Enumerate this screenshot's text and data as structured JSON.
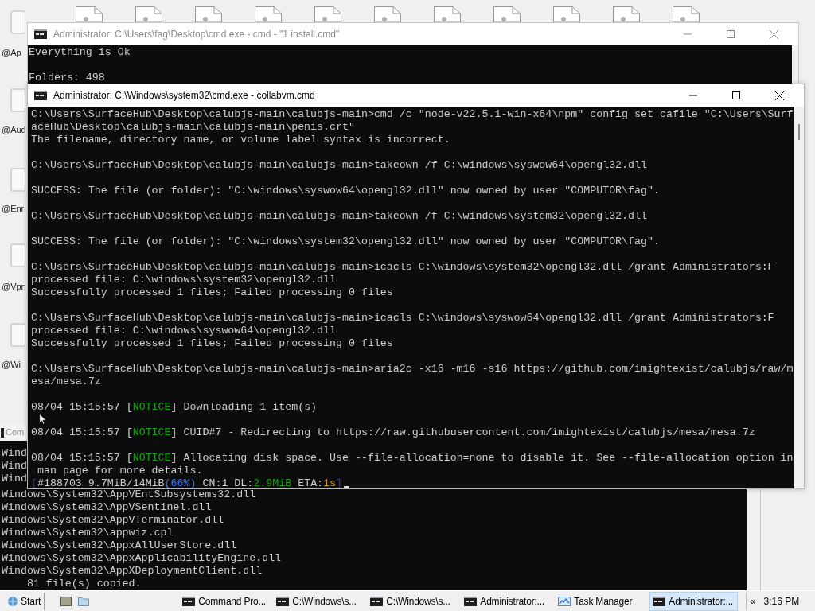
{
  "desktop": {
    "icon_labels": [
      "@Ap",
      "@Aud",
      "@Enr",
      "@Vpn",
      "@Wi"
    ]
  },
  "back_window": {
    "title": "Administrator: C:\\Users\\fag\\Desktop\\cmd.exe - cmd - \"1 install.cmd\"",
    "active": false,
    "lines": [
      {
        "kind": "text",
        "text": "Everything is Ok"
      },
      {
        "kind": "blank"
      },
      {
        "kind": "text",
        "text": "Folders: 498"
      }
    ]
  },
  "bottom_window": {
    "title": "Com",
    "active": false,
    "lines": [
      {
        "kind": "text",
        "text": "Wind"
      },
      {
        "kind": "text",
        "text": "Wind"
      },
      {
        "kind": "text",
        "text": "Wind"
      },
      {
        "kind": "text",
        "text": "Windows\\System32\\AppVEntSubsystems32.dll"
      },
      {
        "kind": "text",
        "text": "Windows\\System32\\AppVSentinel.dll"
      },
      {
        "kind": "text",
        "text": "Windows\\System32\\AppVTerminator.dll"
      },
      {
        "kind": "text",
        "text": "Windows\\System32\\appwiz.cpl"
      },
      {
        "kind": "text",
        "text": "Windows\\System32\\AppxAllUserStore.dll"
      },
      {
        "kind": "text",
        "text": "Windows\\System32\\AppxApplicabilityEngine.dll"
      },
      {
        "kind": "text",
        "text": "Windows\\System32\\AppXDeploymentClient.dll"
      },
      {
        "kind": "text",
        "text": "    81 file(s) copied."
      }
    ]
  },
  "front_window": {
    "title": "Administrator: C:\\Windows\\system32\\cmd.exe - collabvm.cmd",
    "active": true,
    "lines": [
      {
        "kind": "text",
        "text": "C:\\Users\\SurfaceHub\\Desktop\\calubjs-main\\calubjs-main>cmd /c \"node-v22.5.1-win-x64\\npm\" config set cafile \"C:\\Users\\Surf"
      },
      {
        "kind": "text",
        "text": "aceHub\\Desktop\\calubjs-main\\calubjs-main\\penis.crt\""
      },
      {
        "kind": "text",
        "text": "The filename, directory name, or volume label syntax is incorrect."
      },
      {
        "kind": "blank"
      },
      {
        "kind": "text",
        "text": "C:\\Users\\SurfaceHub\\Desktop\\calubjs-main\\calubjs-main>takeown /f C:\\windows\\syswow64\\opengl32.dll"
      },
      {
        "kind": "blank"
      },
      {
        "kind": "text",
        "text": "SUCCESS: The file (or folder): \"C:\\windows\\syswow64\\opengl32.dll\" now owned by user \"COMPUTOR\\fag\"."
      },
      {
        "kind": "blank"
      },
      {
        "kind": "text",
        "text": "C:\\Users\\SurfaceHub\\Desktop\\calubjs-main\\calubjs-main>takeown /f C:\\windows\\system32\\opengl32.dll"
      },
      {
        "kind": "blank"
      },
      {
        "kind": "text",
        "text": "SUCCESS: The file (or folder): \"C:\\windows\\system32\\opengl32.dll\" now owned by user \"COMPUTOR\\fag\"."
      },
      {
        "kind": "blank"
      },
      {
        "kind": "text",
        "text": "C:\\Users\\SurfaceHub\\Desktop\\calubjs-main\\calubjs-main>icacls C:\\windows\\system32\\opengl32.dll /grant Administrators:F"
      },
      {
        "kind": "text",
        "text": "processed file: C:\\windows\\system32\\opengl32.dll"
      },
      {
        "kind": "text",
        "text": "Successfully processed 1 files; Failed processing 0 files"
      },
      {
        "kind": "blank"
      },
      {
        "kind": "text",
        "text": "C:\\Users\\SurfaceHub\\Desktop\\calubjs-main\\calubjs-main>icacls C:\\windows\\syswow64\\opengl32.dll /grant Administrators:F"
      },
      {
        "kind": "text",
        "text": "processed file: C:\\windows\\syswow64\\opengl32.dll"
      },
      {
        "kind": "text",
        "text": "Successfully processed 1 files; Failed processing 0 files"
      },
      {
        "kind": "blank"
      },
      {
        "kind": "text",
        "text": "C:\\Users\\SurfaceHub\\Desktop\\calubjs-main\\calubjs-main>aria2c -x16 -m16 -s16 https://github.com/imightexist/calubjs/raw/m"
      },
      {
        "kind": "text",
        "text": "esa/mesa.7z"
      },
      {
        "kind": "blank"
      },
      {
        "kind": "spans",
        "spans": [
          {
            "text": "08/04 15:15:57 [",
            "color": "#cccccc"
          },
          {
            "text": "NOTICE",
            "color": "#13a10e"
          },
          {
            "text": "] Downloading 1 item(s)",
            "color": "#cccccc"
          }
        ]
      },
      {
        "kind": "blank"
      },
      {
        "kind": "spans",
        "spans": [
          {
            "text": "08/04 15:15:57 [",
            "color": "#cccccc"
          },
          {
            "text": "NOTICE",
            "color": "#13a10e"
          },
          {
            "text": "] CUID#7 - Redirecting to https://raw.githubusercontent.com/imightexist/calubjs/mesa/mesa.7z",
            "color": "#cccccc"
          }
        ]
      },
      {
        "kind": "blank"
      },
      {
        "kind": "spans",
        "spans": [
          {
            "text": "08/04 15:15:57 [",
            "color": "#cccccc"
          },
          {
            "text": "NOTICE",
            "color": "#13a10e"
          },
          {
            "text": "] Allocating disk space. Use --file-allocation=none to disable it. See --file-allocation option in",
            "color": "#cccccc"
          }
        ]
      },
      {
        "kind": "text",
        "text": " man page for more details."
      },
      {
        "kind": "spans",
        "cursor": true,
        "spans": [
          {
            "text": "[",
            "color": "#3a3a6a"
          },
          {
            "text": "#188703 9.7MiB/14MiB",
            "color": "#cccccc"
          },
          {
            "text": "(66%)",
            "color": "#3b78ff"
          },
          {
            "text": " CN:1 DL:",
            "color": "#cccccc"
          },
          {
            "text": "2.9MiB",
            "color": "#13a10e"
          },
          {
            "text": " ETA:",
            "color": "#cccccc"
          },
          {
            "text": "1s",
            "color": "#c19c00"
          },
          {
            "text": "]",
            "color": "#3a3a6a"
          }
        ]
      }
    ]
  },
  "taskbar": {
    "start": "Start",
    "tasks": [
      {
        "label": "Command Pro...",
        "kind": "console",
        "selected": false
      },
      {
        "label": "C:\\Windows\\s...",
        "kind": "console",
        "selected": false
      },
      {
        "label": "C:\\Windows\\s...",
        "kind": "console",
        "selected": false
      },
      {
        "label": "Administrator:...",
        "kind": "console",
        "selected": false
      },
      {
        "label": "Task Manager",
        "kind": "monitor",
        "selected": false
      },
      {
        "label": "Administrator:...",
        "kind": "console",
        "selected": true
      }
    ],
    "tray_toggle": "«",
    "clock": "3:16 PM"
  }
}
